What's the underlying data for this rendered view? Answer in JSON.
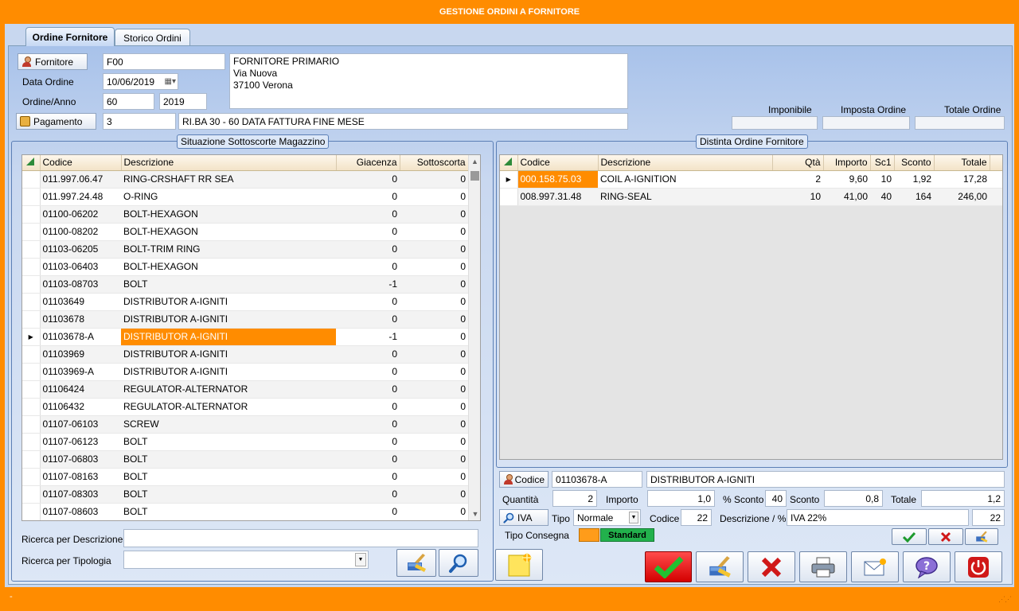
{
  "window": {
    "title": "GESTIONE ORDINI A FORNITORE"
  },
  "tabs": [
    {
      "label": "Ordine Fornitore"
    },
    {
      "label": "Storico Ordini"
    }
  ],
  "header": {
    "fornitore_label": "Fornitore",
    "fornitore_code": "F00",
    "fornitore_address": [
      "FORNITORE PRIMARIO",
      "Via Nuova",
      "37100 Verona"
    ],
    "data_ordine_label": "Data Ordine",
    "data_ordine_value": "10/06/2019",
    "ordine_anno_label": "Ordine/Anno",
    "ordine_value": "60",
    "anno_value": "2019",
    "pagamento_label": "Pagamento",
    "pagamento_code": "3",
    "pagamento_desc": "RI.BA 30 - 60 DATA FATTURA FINE MESE",
    "imponibile_label": "Imponibile",
    "imponibile_value": "",
    "imposta_label": "Imposta Ordine",
    "imposta_value": "",
    "totale_label": "Totale Ordine",
    "totale_value": ""
  },
  "stock": {
    "title": "Situazione Sottoscorte Magazzino",
    "columns": [
      "Codice",
      "Descrizione",
      "Giacenza",
      "Sottoscorta"
    ],
    "selected_index": 9,
    "rows": [
      [
        "011.997.06.47",
        "RING-CRSHAFT RR SEA",
        "0",
        "0"
      ],
      [
        "011.997.24.48",
        "O-RING",
        "0",
        "0"
      ],
      [
        "01100-06202",
        "BOLT-HEXAGON",
        "0",
        "0"
      ],
      [
        "01100-08202",
        "BOLT-HEXAGON",
        "0",
        "0"
      ],
      [
        "01103-06205",
        "BOLT-TRIM RING",
        "0",
        "0"
      ],
      [
        "01103-06403",
        "BOLT-HEXAGON",
        "0",
        "0"
      ],
      [
        "01103-08703",
        "BOLT",
        "-1",
        "0"
      ],
      [
        "01103649",
        "DISTRIBUTOR A-IGNITI",
        "0",
        "0"
      ],
      [
        "01103678",
        "DISTRIBUTOR A-IGNITI",
        "0",
        "0"
      ],
      [
        "01103678-A",
        "DISTRIBUTOR A-IGNITI",
        "-1",
        "0"
      ],
      [
        "01103969",
        "DISTRIBUTOR A-IGNITI",
        "0",
        "0"
      ],
      [
        "01103969-A",
        "DISTRIBUTOR A-IGNITI",
        "0",
        "0"
      ],
      [
        "01106424",
        "REGULATOR-ALTERNATOR",
        "0",
        "0"
      ],
      [
        "01106432",
        "REGULATOR-ALTERNATOR",
        "0",
        "0"
      ],
      [
        "01107-06103",
        "SCREW",
        "0",
        "0"
      ],
      [
        "01107-06123",
        "BOLT",
        "0",
        "0"
      ],
      [
        "01107-06803",
        "BOLT",
        "0",
        "0"
      ],
      [
        "01107-08163",
        "BOLT",
        "0",
        "0"
      ],
      [
        "01107-08303",
        "BOLT",
        "0",
        "0"
      ],
      [
        "01107-08603",
        "BOLT",
        "0",
        "0"
      ]
    ],
    "search_desc_label": "Ricerca per Descrizione",
    "search_desc_value": "",
    "search_type_label": "Ricerca per Tipologia",
    "search_type_value": ""
  },
  "order": {
    "title": "Distinta Ordine Fornitore",
    "columns": [
      "Codice",
      "Descrizione",
      "Qtà",
      "Importo",
      "Sc1",
      "Sconto",
      "Totale"
    ],
    "selected_index": 0,
    "rows": [
      [
        "000.158.75.03",
        "COIL A-IGNITION",
        "2",
        "9,60",
        "10",
        "1,92",
        "17,28"
      ],
      [
        "008.997.31.48",
        "RING-SEAL",
        "10",
        "41,00",
        "40",
        "164",
        "246,00"
      ]
    ]
  },
  "detail": {
    "codice_label": "Codice",
    "codice_value": "01103678-A",
    "descrizione_value": "DISTRIBUTOR A-IGNITI",
    "quantita_label": "Quantità",
    "quantita_value": "2",
    "importo_label": "Importo",
    "importo_value": "1,0",
    "psconto_label": "% Sconto",
    "psconto_value": "40",
    "sconto_label": "Sconto",
    "sconto_value": "0,8",
    "totale_label": "Totale",
    "totale_value": "1,2",
    "iva_label": "IVA",
    "tipo_label": "Tipo",
    "tipo_value": "Normale",
    "iva_codice_label": "Codice",
    "iva_codice_value": "22",
    "iva_desc_label": "Descrizione / %",
    "iva_desc_value": "IVA 22%",
    "iva_pct_value": "22",
    "consegna_label": "Tipo Consegna",
    "consegna_value": "Standard"
  },
  "status": {
    "text": "-"
  },
  "colors": {
    "accent": "#ff8c00",
    "selection": "#ff8c00",
    "standard": "#22b14c"
  }
}
